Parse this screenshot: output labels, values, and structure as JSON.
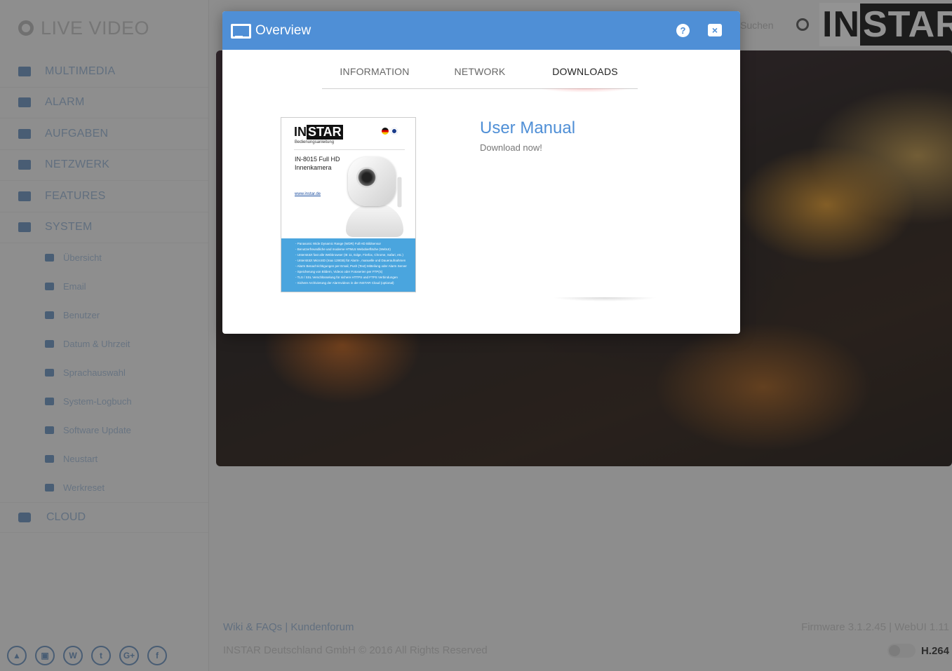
{
  "app": {
    "logo_text": "LIVE VIDEO",
    "brand": {
      "part1": "IN",
      "part2": "STAR"
    },
    "search_placeholder": "Suchen"
  },
  "sidebar": {
    "items": [
      {
        "label": "MULTIMEDIA",
        "icon": "image-icon"
      },
      {
        "label": "ALARM",
        "icon": "bell-icon"
      },
      {
        "label": "AUFGABEN",
        "icon": "film-icon"
      },
      {
        "label": "NETZWERK",
        "icon": "network-icon"
      },
      {
        "label": "FEATURES",
        "icon": "circle-icon"
      },
      {
        "label": "SYSTEM",
        "icon": "gear-icon"
      }
    ],
    "system_subitems": [
      {
        "label": "Übersicht",
        "icon": "monitor-icon"
      },
      {
        "label": "Email",
        "icon": "envelope-icon"
      },
      {
        "label": "Benutzer",
        "icon": "user-icon"
      },
      {
        "label": "Datum & Uhrzeit",
        "icon": "clock-icon"
      },
      {
        "label": "Sprachauswahl",
        "icon": "globe-icon"
      },
      {
        "label": "System-Logbuch",
        "icon": "book-icon"
      },
      {
        "label": "Software Update",
        "icon": "refresh-icon"
      },
      {
        "label": "Neustart",
        "icon": "power-icon"
      },
      {
        "label": "Werkreset",
        "icon": "wrench-icon"
      }
    ],
    "cloud": {
      "label": "CLOUD",
      "icon": "cloud-icon"
    },
    "social": [
      "▲",
      "▣",
      "W",
      "t",
      "G+",
      "f"
    ]
  },
  "footer": {
    "links": "Wiki & FAQs | Kundenforum",
    "copyright": "INSTAR Deutschland GmbH © 2016 All Rights Reserved",
    "firmware": "Firmware 3.1.2.45 | WebUI 1.11",
    "codec": "H.264"
  },
  "modal": {
    "title": "Overview",
    "help_label": "?",
    "close_label": "×",
    "tabs": [
      "INFORMATION",
      "NETWORK",
      "DOWNLOADS"
    ],
    "active_tab": "DOWNLOADS",
    "manual": {
      "title": "User Manual",
      "subtitle": "Download now!",
      "cover": {
        "brand1": "IN",
        "brand2": "STAR",
        "subtitle": "Bedienungsanleitung",
        "model": "IN-8015 Full HD Innenkamera",
        "url": "www.instar.de",
        "features": [
          "- Panasonic Wide Dynamic Range (WDR) Full HD Bildsensor",
          "- Benutzerfreundliche und moderne HTML5 Weboberfläche (WebUI)",
          "- Unterstützt fast alle Webbrowser (IE 11, Edge, Firefox, Chrome, Safari, etc.)",
          "- Unterstützt MicroSD (max 128GB) für Alarm-, manuelle und Daueraufnahmen",
          "- Alarm Benachrichtigungen per Email, Push (Text) Mitteilung oder Alarm Server",
          "- Speicherung von Bildern, Videos oder Fotoserien per FTP(S)",
          "- TLS / SSL Verschlüsselung für sichere HTTPS und FTPS Verbindungen",
          "- Sichere Archivierung der Alarmvideos in der INSTAR Cloud (optional)"
        ]
      }
    }
  },
  "colors": {
    "accent": "#4f8fd6",
    "overlay": "rgba(40,40,40,0.5)"
  }
}
